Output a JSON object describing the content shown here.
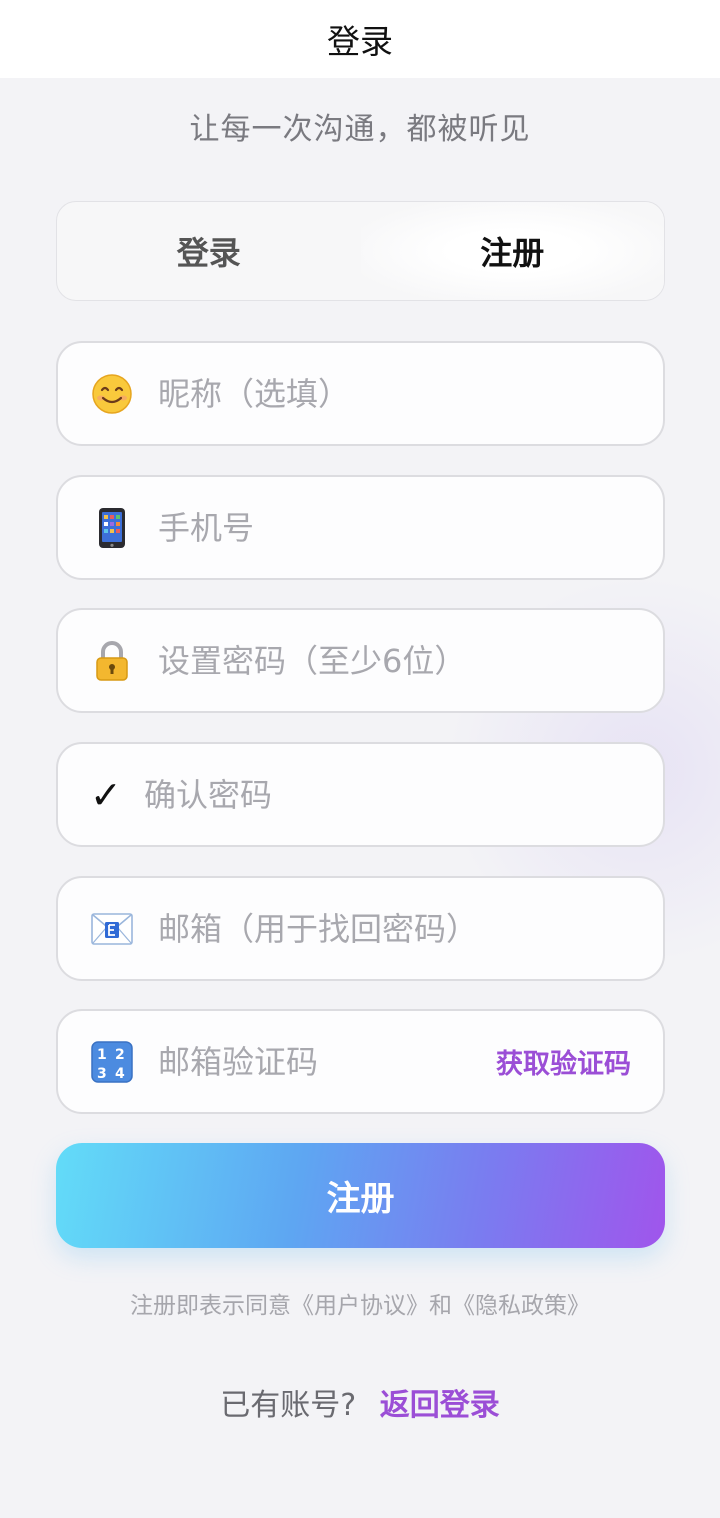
{
  "header": {
    "title": "登录"
  },
  "slogan": "让每一次沟通，都被听见",
  "tabs": [
    {
      "label": "登录",
      "active": false
    },
    {
      "label": "注册",
      "active": true
    }
  ],
  "form": {
    "nickname": {
      "icon": "smiley-face-icon",
      "placeholder": "昵称（选填）",
      "value": ""
    },
    "phone": {
      "icon": "mobile-phone-icon",
      "placeholder": "手机号",
      "value": ""
    },
    "password": {
      "icon": "lock-icon",
      "placeholder": "设置密码（至少6位）",
      "value": ""
    },
    "confirm_password": {
      "icon": "check-mark-icon",
      "placeholder": "确认密码",
      "value": ""
    },
    "email": {
      "icon": "email-icon",
      "placeholder": "邮箱（用于找回密码）",
      "value": ""
    },
    "email_code": {
      "icon": "number-keycap-icon",
      "placeholder": "邮箱验证码",
      "value": "",
      "action_label": "获取验证码"
    }
  },
  "submit_label": "注册",
  "agreement": {
    "prefix": "注册即表示同意",
    "user_agreement": "《用户协议》",
    "and": "和",
    "privacy_policy": "《隐私政策》"
  },
  "footer": {
    "question": "已有账号?",
    "link": "返回登录"
  },
  "colors": {
    "accent": "#9b4ed6",
    "gradient_start": "#62dcf8",
    "gradient_end": "#a055ec",
    "background": "#f3f3f6"
  }
}
